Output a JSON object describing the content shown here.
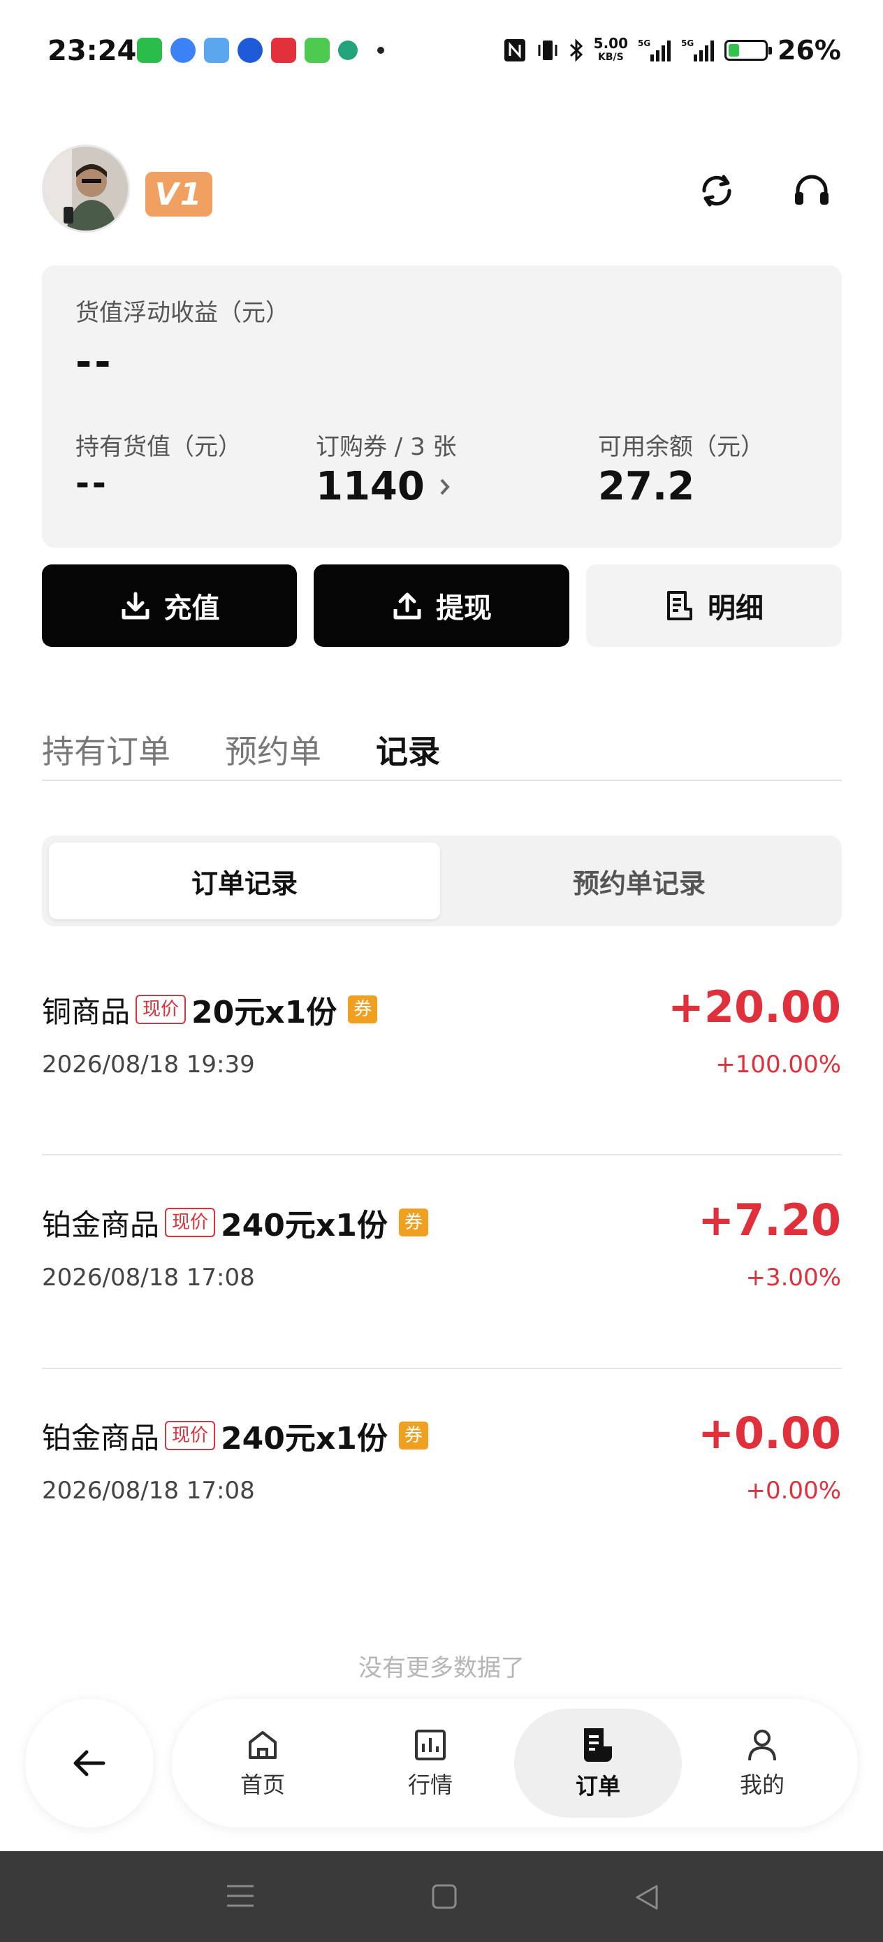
{
  "status_bar": {
    "time": "23:24",
    "net_speed_value": "5.00",
    "net_speed_unit": "KB/S",
    "battery_percent": "26%",
    "battery_level": 0.26
  },
  "header": {
    "vip_label": "V1",
    "refresh_icon": "refresh-icon",
    "support_icon": "headset-icon"
  },
  "asset_card": {
    "floating_income_label": "货值浮动收益（元）",
    "floating_income_value": "--",
    "holding_value_label": "持有货值（元）",
    "holding_value_value": "--",
    "coupon_label": "订购券 / 3 张",
    "coupon_value": "1140",
    "balance_label": "可用余额（元）",
    "balance_value": "27.2"
  },
  "actions": {
    "recharge": "充值",
    "withdraw": "提现",
    "detail": "明细"
  },
  "tabs": [
    {
      "label": "持有订单",
      "active": false
    },
    {
      "label": "预约单",
      "active": false
    },
    {
      "label": "记录",
      "active": true
    }
  ],
  "segments": [
    {
      "label": "订单记录",
      "active": true
    },
    {
      "label": "预约单记录",
      "active": false
    }
  ],
  "records": [
    {
      "name": "铜商品",
      "price_tag": "现价",
      "spec": "20元x1份",
      "coupon": "券",
      "time": "2026/08/18 19:39",
      "amount": "+20.00",
      "percent": "+100.00%"
    },
    {
      "name": "铂金商品",
      "price_tag": "现价",
      "spec": "240元x1份",
      "coupon": "券",
      "time": "2026/08/18 17:08",
      "amount": "+7.20",
      "percent": "+3.00%"
    },
    {
      "name": "铂金商品",
      "price_tag": "现价",
      "spec": "240元x1份",
      "coupon": "券",
      "time": "2026/08/18 17:08",
      "amount": "+0.00",
      "percent": "+0.00%"
    }
  ],
  "no_more_text": "没有更多数据了",
  "bottom_nav": [
    {
      "label": "首页",
      "icon": "home-icon",
      "active": false
    },
    {
      "label": "行情",
      "icon": "chart-icon",
      "active": false
    },
    {
      "label": "订单",
      "icon": "order-icon",
      "active": true
    },
    {
      "label": "我的",
      "icon": "user-icon",
      "active": false
    }
  ],
  "colors": {
    "accent_red": "#e0303b",
    "coupon_orange": "#f0a020",
    "vip_orange": "#f0a060",
    "dark_button": "#050505"
  }
}
